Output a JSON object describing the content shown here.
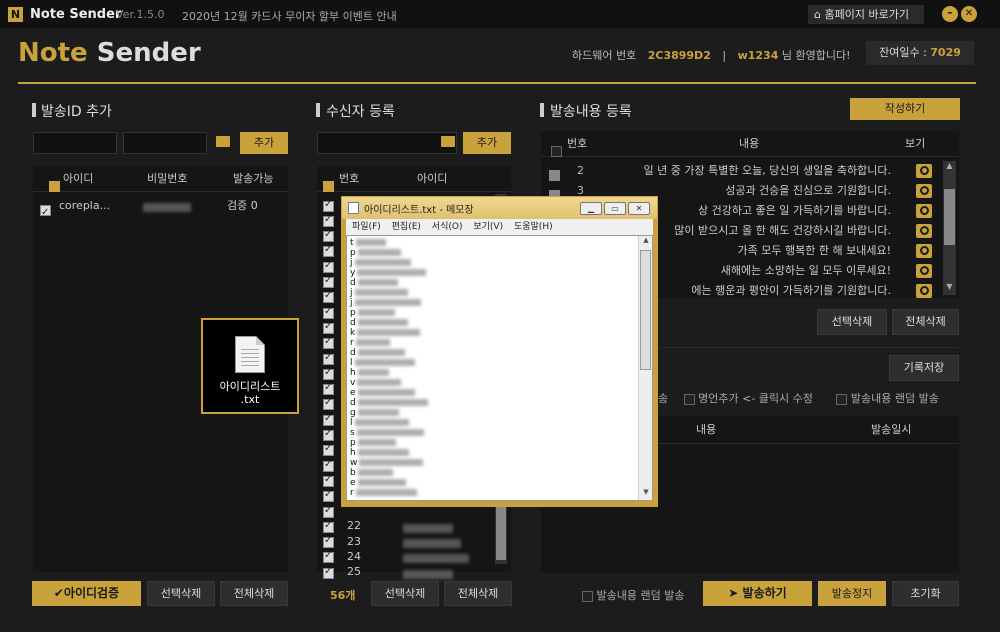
{
  "titlebar": {
    "app_name": "Note Sender",
    "version": "Ver.1.5.0",
    "notice": "2020년 12월 카드사 무이자 할부 이벤트 안내",
    "homepage_label": "홈페이지 바로가기"
  },
  "header": {
    "logo_note": "Note",
    "logo_sender": "Sender",
    "hw_label": "하드웨어 번호",
    "hw_value": "2C3899D2",
    "separator": "|",
    "user_id": "w1234",
    "welcome": "님 환영합니다!",
    "days_label": "잔여일수 :",
    "days_value": "7029"
  },
  "id_panel": {
    "title": "발송ID 추가",
    "add_label": "추가",
    "columns": [
      "아이디",
      "비밀번호",
      "발송가능"
    ],
    "rows": [
      {
        "id": "corepla...",
        "status": "검증 0"
      }
    ],
    "verify_label": "아이디검증",
    "delete_selected_label": "선택삭제",
    "delete_all_label": "전체삭제"
  },
  "recipient_panel": {
    "title": "수신자 등록",
    "add_label": "추가",
    "columns": [
      "번호",
      "아이디"
    ],
    "row_numbers": [
      "22",
      "23",
      "24",
      "25"
    ],
    "count_label": "56개",
    "delete_selected_label": "선택삭제",
    "delete_all_label": "전체삭제"
  },
  "content_panel": {
    "title": "발송내용 등록",
    "write_label": "작성하기",
    "columns": [
      "번호",
      "내용",
      "보기"
    ],
    "rows": [
      {
        "no": "2",
        "text": "일 년 중 가장 특별한 오늘, 당신의 생일을 축하합니다."
      },
      {
        "no": "3",
        "text": "성공과 건승을 진심으로 기원합니다."
      },
      {
        "no": "",
        "text": "상 건강하고 좋은 일 가득하기를 바랍니다."
      },
      {
        "no": "",
        "text": "많이 받으시고 올 한 해도 건강하시길 바랍니다."
      },
      {
        "no": "",
        "text": "가족 모두 행복한 한 해 보내세요!"
      },
      {
        "no": "",
        "text": "새해에는 소망하는 일 모두 이루세요!"
      },
      {
        "no": "",
        "text": "에는 행운과 평안이 가득하기를 기원합니다."
      }
    ],
    "delete_selected_label": "선택삭제",
    "delete_all_label": "전체삭제",
    "save_log_label": "기록저장",
    "option1": "송",
    "option2": "명언추가 <- 클릭시 수정",
    "option3": "발송내용 랜덤 발송",
    "log_columns": [
      "내용",
      "발송일시"
    ]
  },
  "footer": {
    "random_label": "발송내용 랜덤 발송",
    "send_label": "발송하기",
    "stop_label": "발송정지",
    "reset_label": "초기화"
  },
  "desktop_file": {
    "name_line1": "아이디리스트",
    "name_line2": ".txt"
  },
  "notepad": {
    "title": "아이디리스트.txt - 메모장",
    "menu": [
      "파일(F)",
      "편집(E)",
      "서식(O)",
      "보기(V)",
      "도움말(H)"
    ],
    "line_initials": [
      "t",
      "p",
      "j",
      "y",
      "d",
      "j",
      "j",
      "p",
      "d",
      "k",
      "r",
      "d",
      "l",
      "h",
      "v",
      "e",
      "d",
      "g",
      "l",
      "s",
      "p",
      "h",
      "w",
      "b",
      "e",
      "r"
    ]
  },
  "colors": {
    "accent": "#c9a23c",
    "background": "#1c1c1c",
    "panel": "#151515"
  }
}
